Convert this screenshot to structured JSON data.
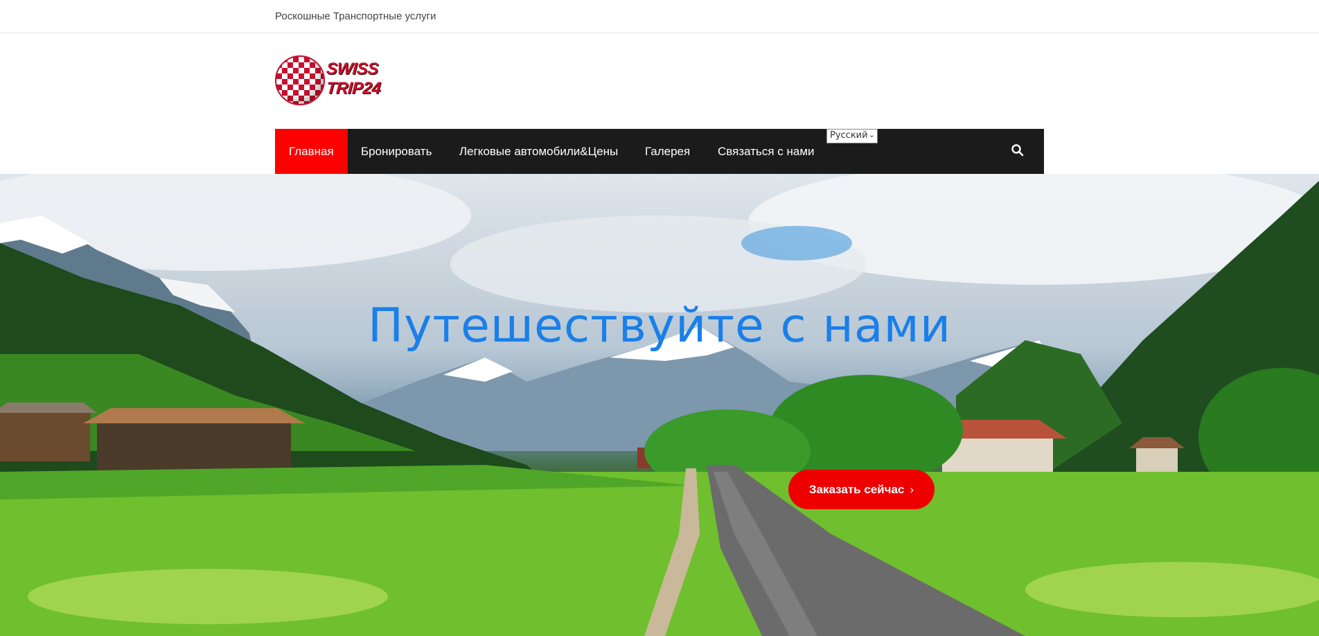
{
  "topbar": {
    "tagline": "Роскошные Транспортные услуги"
  },
  "logo": {
    "line1": "SWISS",
    "line2": "TRIP24"
  },
  "nav": {
    "items": [
      {
        "label": "Главная",
        "active": true
      },
      {
        "label": "Бронировать",
        "active": false
      },
      {
        "label": "Легковые автомобили&Цены",
        "active": false
      },
      {
        "label": "Галерея",
        "active": false
      },
      {
        "label": "Связаться с нами",
        "active": false
      }
    ],
    "language_select": "Русский",
    "search_icon": "search-icon"
  },
  "hero": {
    "title": "Путешествуйте с нами",
    "cta_label": "Заказать сейчас",
    "cta_icon": "chevron-right-icon"
  },
  "colors": {
    "accent": "#ff0000",
    "nav_bg": "#1b1b1b",
    "title": "#1a7fe8"
  }
}
